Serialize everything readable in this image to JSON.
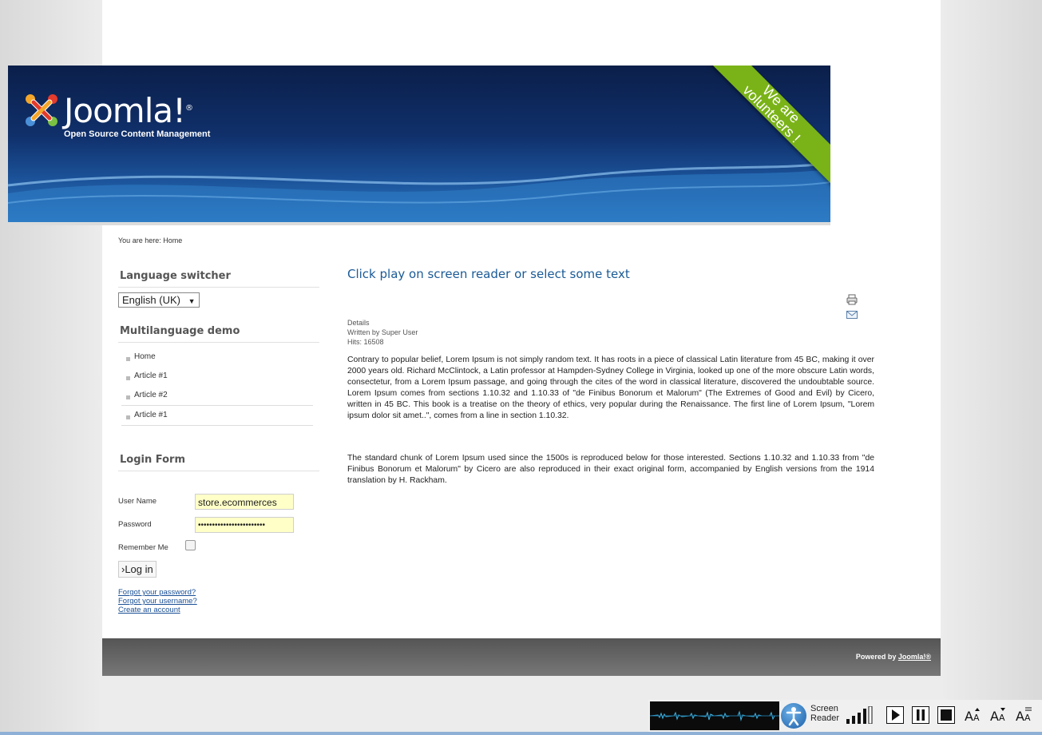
{
  "header": {
    "logo_text": "Joomla!",
    "logo_reg": "®",
    "tagline": "Open Source Content Management",
    "ribbon_line1": "We are",
    "ribbon_line2": "volunteers !"
  },
  "breadcrumb": "You are here: Home",
  "language_module": {
    "title": "Language switcher",
    "selected": "English (UK)"
  },
  "menu_module": {
    "title": "Multilanguage demo",
    "items": [
      "Home",
      "Article #1",
      "Article #2",
      "Article #1"
    ]
  },
  "login_module": {
    "title": "Login Form",
    "username_label": "User Name",
    "username_value": "store.ecommerces",
    "password_label": "Password",
    "password_value": "••••••••••••••••••••••••",
    "remember_label": "Remember Me",
    "login_button": "›Log in",
    "forgot_password": "Forgot your password?",
    "forgot_username": "Forgot your username?",
    "create_account": "Create an account"
  },
  "article": {
    "title": "Click play on screen reader or select some text",
    "details_label": "Details",
    "written_by": "Written by Super User",
    "hits": "Hits: 16508",
    "paragraph1": "Contrary to popular belief, Lorem Ipsum is not simply random text. It has roots in a piece of classical Latin literature from 45 BC, making it over 2000 years old. Richard McClintock, a Latin professor at Hampden-Sydney College in Virginia, looked up one of the more obscure Latin words, consectetur, from a Lorem Ipsum passage, and going through the cites of the word in classical literature, discovered the undoubtable source. Lorem Ipsum comes from sections 1.10.32 and 1.10.33 of \"de Finibus Bonorum et Malorum\" (The Extremes of Good and Evil) by Cicero, written in 45 BC. This book is a treatise on the theory of ethics, very popular during the Renaissance. The first line of Lorem Ipsum, \"Lorem ipsum dolor sit amet..\", comes from a line in section 1.10.32.",
    "paragraph2": "The standard chunk of Lorem Ipsum used since the 1500s is reproduced below for those interested. Sections 1.10.32 and 1.10.33 from \"de Finibus Bonorum et Malorum\" by Cicero are also reproduced in their exact original form, accompanied by English versions from the 1914 translation by H. Rackham."
  },
  "footer": {
    "powered_by": "Powered by ",
    "link": "Joomla!®"
  },
  "screen_reader": {
    "label_line1": "Screen",
    "label_line2": "Reader"
  },
  "colors": {
    "title_blue": "#1a5a96",
    "ribbon_green": "#7ab317",
    "input_yellow": "#ffffc8"
  }
}
